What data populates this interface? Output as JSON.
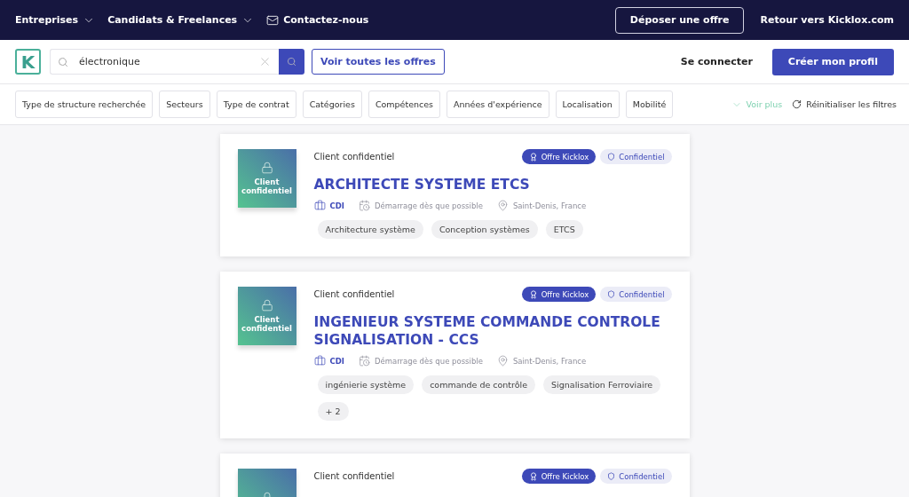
{
  "top_nav": {
    "links": [
      {
        "label": "Entreprises",
        "kind": "dropdown"
      },
      {
        "label": "Candidats & Freelances",
        "kind": "dropdown"
      },
      {
        "label": "Contactez-nous",
        "kind": "mail"
      }
    ],
    "post_button": "Déposer une offre",
    "back_link": "Retour vers Kicklox.com"
  },
  "search_bar": {
    "logo": "K",
    "query": "électronique",
    "all_offers_button": "Voir toutes les offres",
    "login_link": "Se connecter",
    "signup_button": "Créer mon profil"
  },
  "filters": [
    "Type de structure recherchée",
    "Secteurs",
    "Type de contrat",
    "Catégories",
    "Compétences",
    "Années d'expérience",
    "Localisation",
    "Mobilité"
  ],
  "more_filters": "Voir plus",
  "reset_filters": "Réinitialiser les filtres",
  "jobs": [
    {
      "logo_text": "Client confidentiel",
      "company": "Client confidentiel",
      "badges": [
        "Offre Kicklox",
        "Confidentiel"
      ],
      "title": "ARCHITECTE SYSTEME ETCS",
      "contract": "CDI",
      "start": "Démarrage dès que possible",
      "location": "Saint-Denis, France",
      "tags": [
        "Architecture système",
        "Conception systèmes",
        "ETCS"
      ]
    },
    {
      "logo_text": "Client confidentiel",
      "company": "Client confidentiel",
      "badges": [
        "Offre Kicklox",
        "Confidentiel"
      ],
      "title": "INGENIEUR SYSTEME COMMANDE CONTROLE SIGNALISATION - CCS",
      "contract": "CDI",
      "start": "Démarrage dès que possible",
      "location": "Saint-Denis, France",
      "tags": [
        "ingénierie système",
        "commande de contrôle",
        "Signalisation Ferroviaire",
        "+ 2"
      ]
    },
    {
      "company": "Client confidentiel",
      "badges": [
        "Offre Kicklox",
        "Confidentiel"
      ]
    }
  ]
}
